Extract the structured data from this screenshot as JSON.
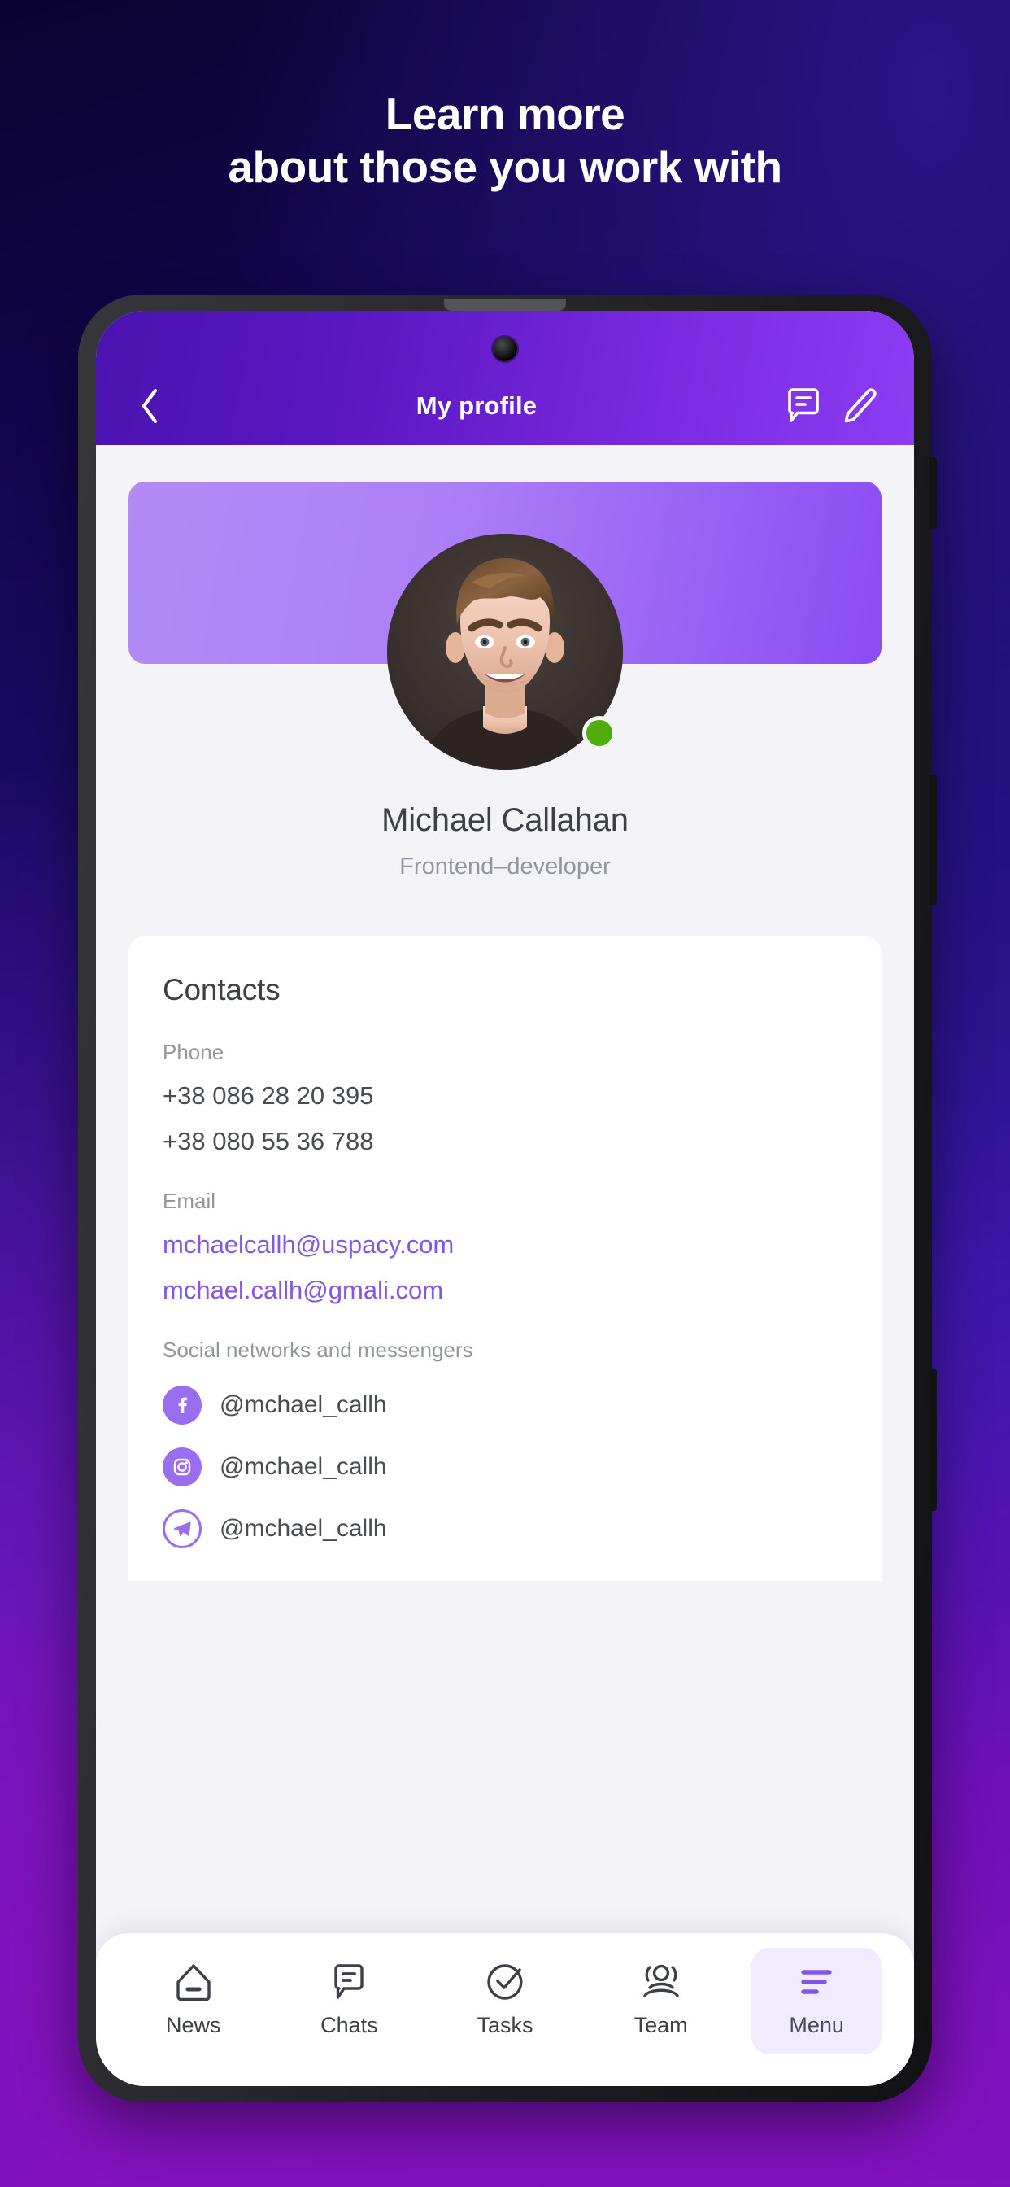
{
  "promo": {
    "headline_line1": "Learn more",
    "headline_line2": "about those you work with"
  },
  "colors": {
    "accent_purple": "#8257e6",
    "appbar_gradient_start": "#4a13b0",
    "appbar_gradient_end": "#8c3df2",
    "banner_gradient_start": "#b38bf5",
    "banner_gradient_end": "#8b4cf3",
    "status_online": "#4dae0c",
    "social_badge": "#9a6ef0",
    "screen_background": "#f4f4f8",
    "card_background": "#ffffff",
    "text_primary": "#3e4049",
    "text_secondary": "#9396a0",
    "nav_active_background": "#f1ecfd"
  },
  "appbar": {
    "title": "My profile",
    "back_icon": "chevron-left-icon",
    "chat_icon": "chat-bubble-icon",
    "edit_icon": "pencil-icon"
  },
  "profile": {
    "name": "Michael Callahan",
    "role": "Frontend–developer",
    "status": "online",
    "avatar_alt": "Michael Callahan avatar"
  },
  "contacts": {
    "title": "Contacts",
    "phone_label": "Phone",
    "phones": [
      "+38 086 28 20 395",
      "+38 080 55 36 788"
    ],
    "email_label": "Email",
    "emails": [
      "mchaelcallh@uspacy.com",
      "mchael.callh@gmali.com"
    ],
    "social_label": "Social networks and messengers",
    "socials": [
      {
        "network": "facebook",
        "icon": "facebook-icon",
        "handle": "@mchael_callh"
      },
      {
        "network": "instagram",
        "icon": "instagram-icon",
        "handle": "@mchael_callh"
      },
      {
        "network": "telegram",
        "icon": "telegram-icon",
        "handle": "@mchael_callh"
      }
    ]
  },
  "bottom_nav": {
    "items": [
      {
        "label": "News",
        "icon": "home-icon",
        "active": false
      },
      {
        "label": "Chats",
        "icon": "chat-icon",
        "active": false
      },
      {
        "label": "Tasks",
        "icon": "task-check-icon",
        "active": false
      },
      {
        "label": "Team",
        "icon": "people-icon",
        "active": false
      },
      {
        "label": "Menu",
        "icon": "hamburger-icon",
        "active": true
      }
    ]
  }
}
